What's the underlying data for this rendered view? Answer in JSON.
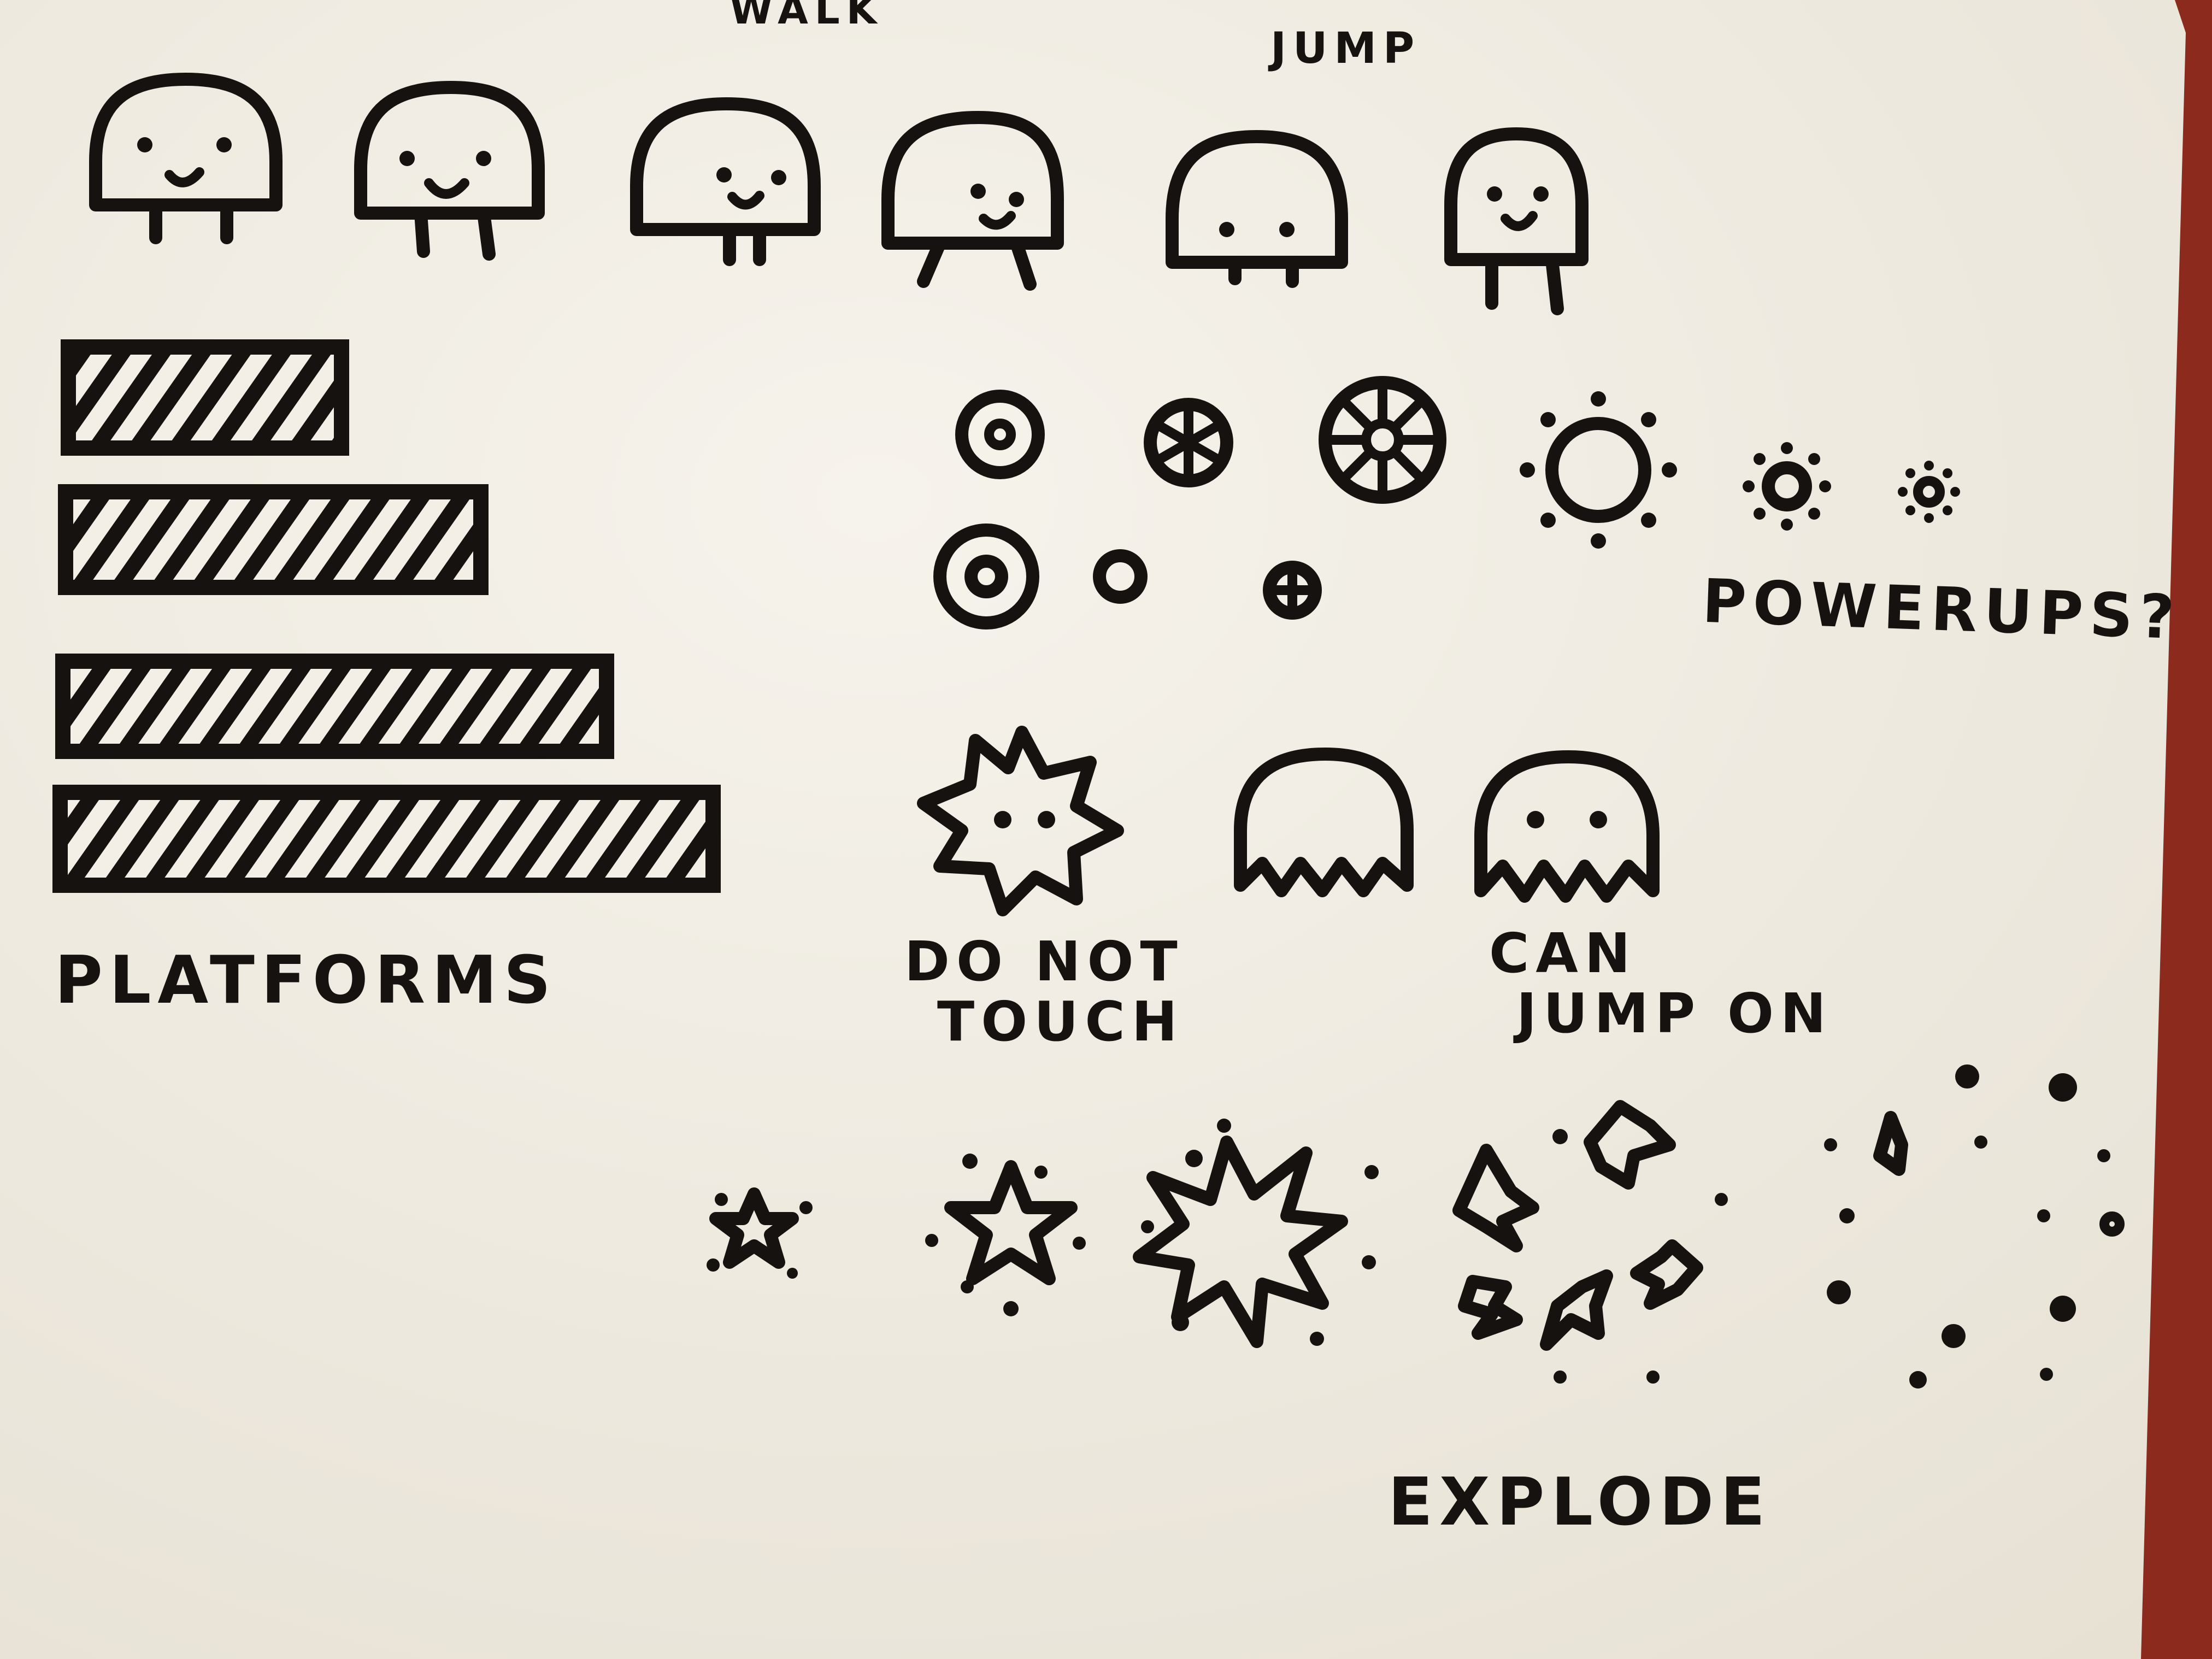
{
  "labels": {
    "walk": "WALK",
    "jump": "JUMP",
    "powerups": "POWERUPS?",
    "platforms": "PLATFORMS",
    "do_not_touch_line1": "DO NOT",
    "do_not_touch_line2": "TOUCH",
    "can_jump_on_line1": "CAN",
    "can_jump_on_line2": "JUMP ON",
    "explode": "EXPLODE"
  },
  "colors": {
    "paper": "#f3efe6",
    "ink": "#161210",
    "background": "#8b2a1d"
  }
}
